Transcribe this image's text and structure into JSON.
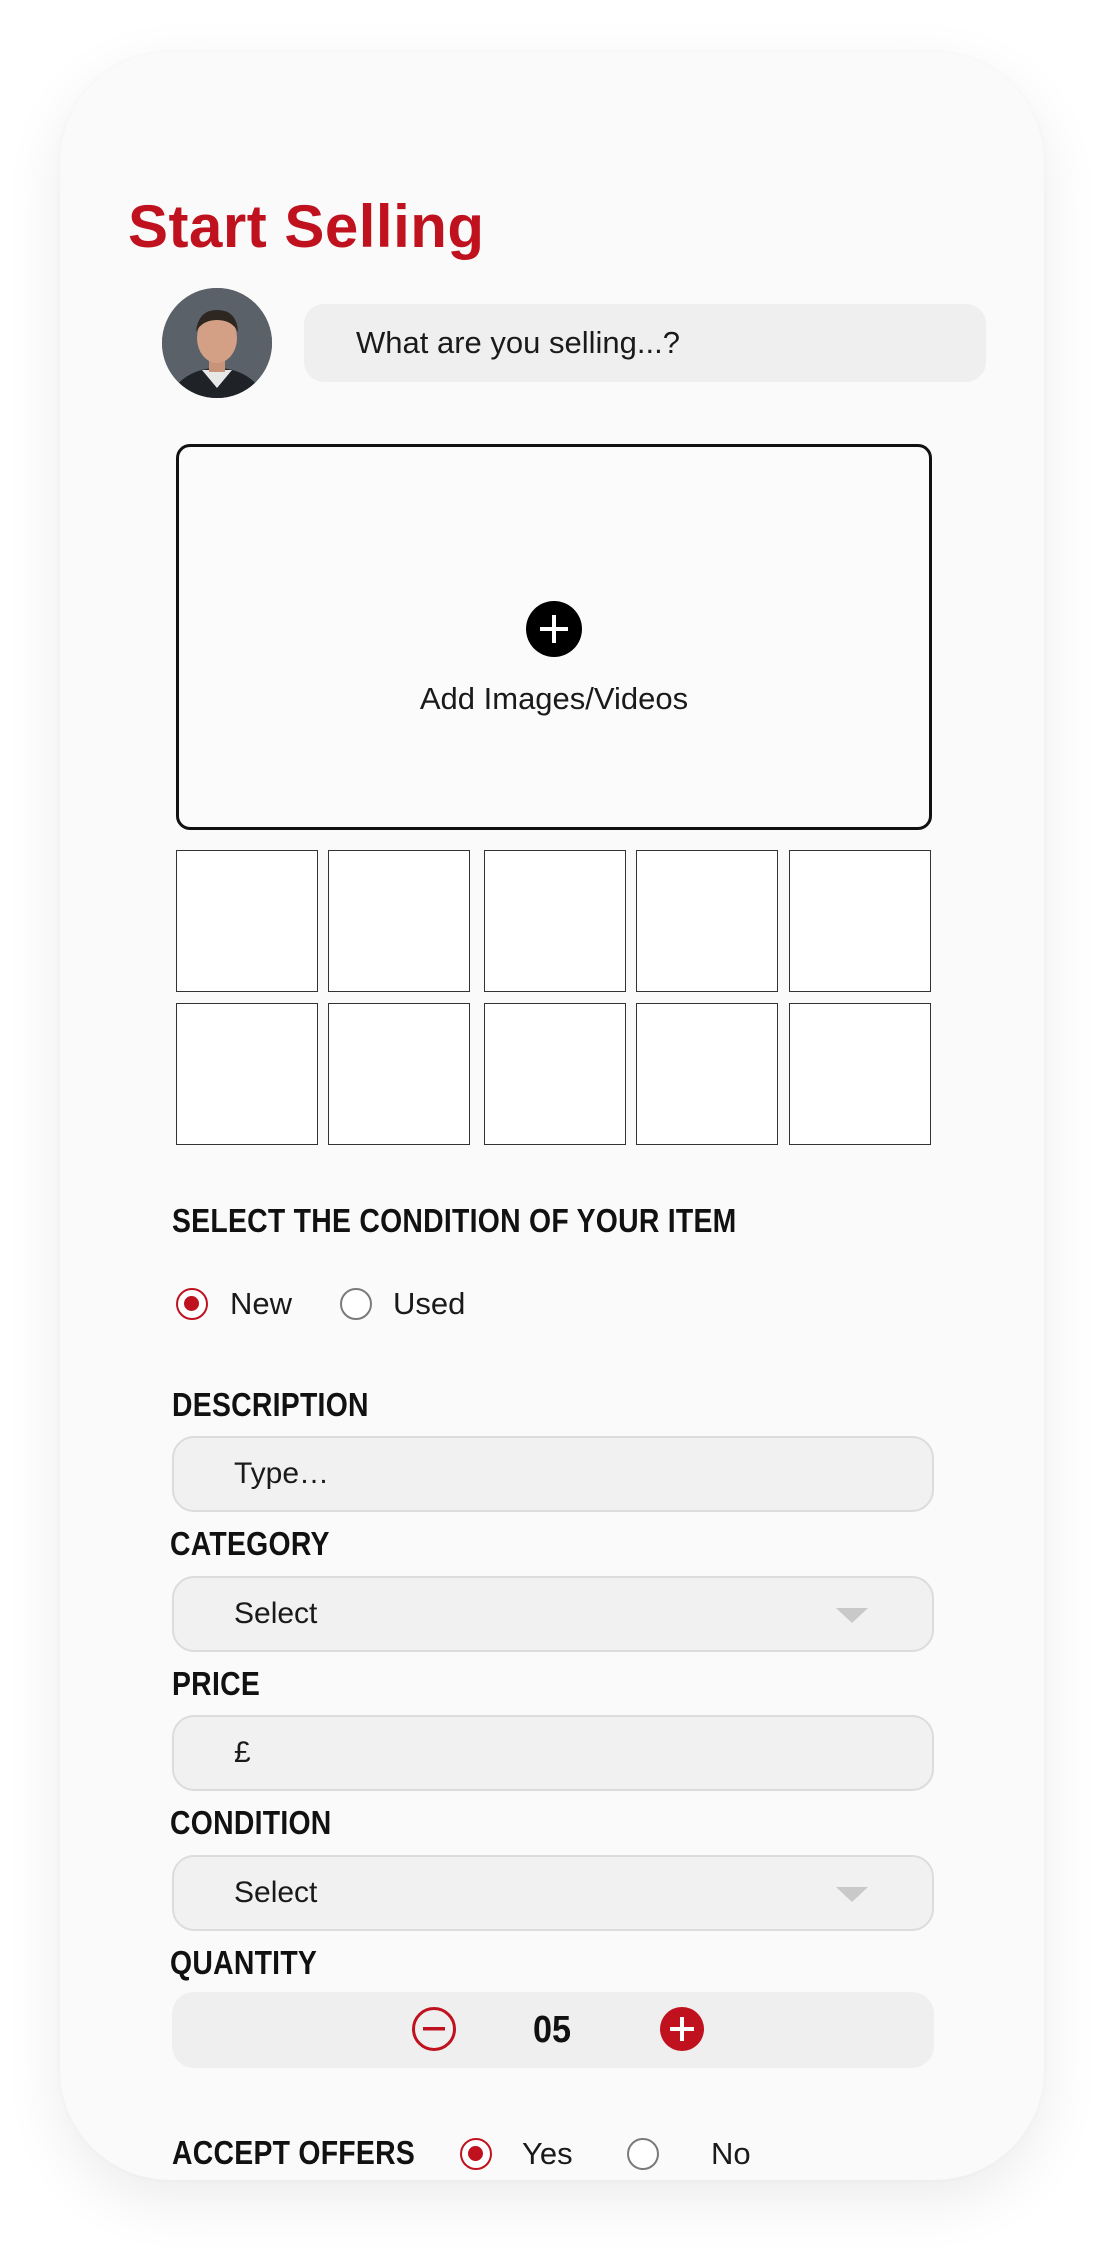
{
  "page": {
    "title": "Start Selling",
    "search_placeholder": "What are you selling...?"
  },
  "media": {
    "add_label": "Add Images/Videos",
    "thumbnail_slots": 10
  },
  "condition_section": {
    "heading": "SELECT THE CONDITION OF YOUR ITEM",
    "options": [
      {
        "label": "New",
        "selected": true
      },
      {
        "label": "Used",
        "selected": false
      }
    ]
  },
  "form": {
    "description": {
      "label": "DESCRIPTION",
      "placeholder": "Type…"
    },
    "category": {
      "label": "CATEGORY",
      "value": "Select"
    },
    "price": {
      "label": "PRICE",
      "value": "£"
    },
    "condition": {
      "label": "CONDITION",
      "value": "Select"
    },
    "quantity": {
      "label": "QUANTITY",
      "value": "05"
    },
    "accept_offers": {
      "label": "ACCEPT OFFERS",
      "options": [
        {
          "label": "Yes",
          "selected": true
        },
        {
          "label": "No",
          "selected": false
        }
      ]
    }
  },
  "colors": {
    "accent": "#c0121e",
    "field_bg": "#f1f1f1",
    "card_bg": "#fafafa"
  }
}
